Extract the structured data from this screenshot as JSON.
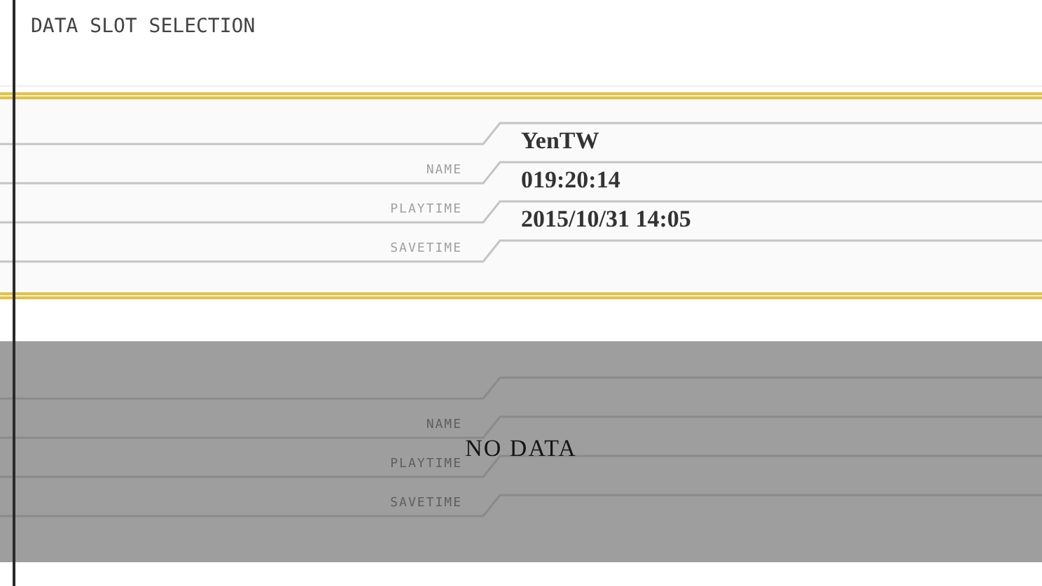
{
  "title": "DATA SLOT SELECTION",
  "slots": [
    {
      "kind": "filled",
      "fields": [
        {
          "label": "NAME",
          "value": "YenTW"
        },
        {
          "label": "PLAYTIME",
          "value": "019:20:14"
        },
        {
          "label": "SAVETIME",
          "value": "2015/10/31 14:05"
        }
      ]
    },
    {
      "kind": "empty",
      "fields": [
        {
          "label": "NAME"
        },
        {
          "label": "PLAYTIME"
        },
        {
          "label": "SAVETIME"
        }
      ],
      "message": "NO DATA"
    }
  ]
}
